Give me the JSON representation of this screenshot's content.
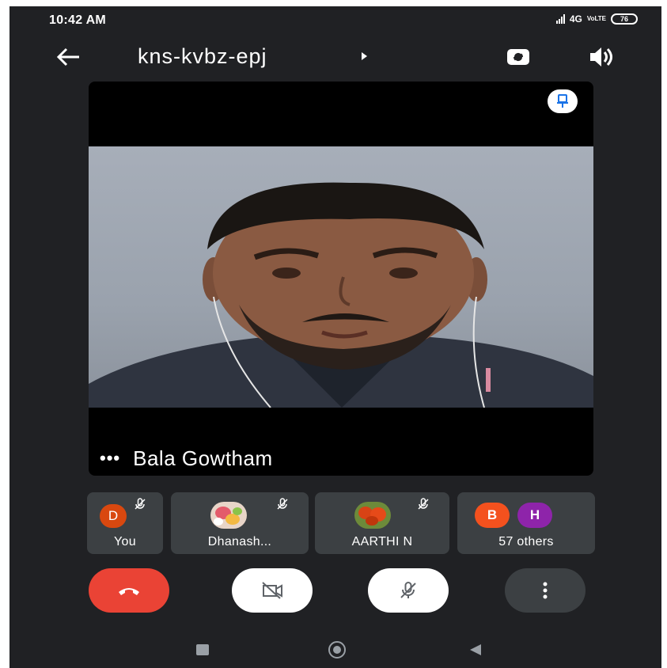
{
  "status_bar": {
    "time": "10:42 AM",
    "network": "4G",
    "volte": "VoLTE",
    "battery": "76"
  },
  "header": {
    "meeting_code": "kns-kvbz-epj"
  },
  "main_tile": {
    "participant_name": "Bala Gowtham",
    "more_dots": "•••"
  },
  "thumbnails": [
    {
      "label": "You",
      "avatar_letter": "D",
      "muted": true
    },
    {
      "label": "Dhanash...",
      "muted": true
    },
    {
      "label": "AARTHI N",
      "muted": true
    },
    {
      "label": "57 others",
      "avatar_letters": [
        "B",
        "H"
      ]
    }
  ],
  "icons": {
    "back": "arrow-left-icon",
    "dropdown": "caret-right-icon",
    "switch_camera": "switch-camera-icon",
    "speaker": "speaker-icon",
    "pin": "pin-icon",
    "end_call": "phone-hangup-icon",
    "camera_off": "camera-off-icon",
    "mic_off": "mic-off-icon",
    "more": "more-vertical-icon"
  },
  "colors": {
    "background": "#202124",
    "end_call": "#ea4335",
    "pin_blue": "#1a73e8",
    "tile_bg": "#3c4043"
  }
}
